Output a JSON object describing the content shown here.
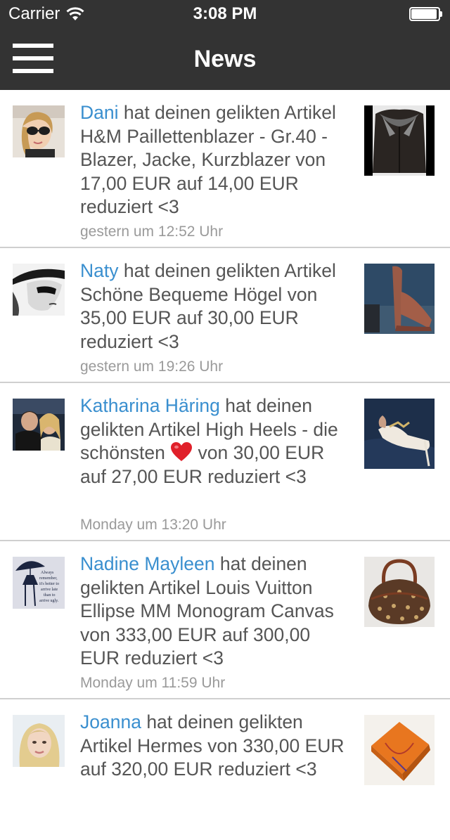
{
  "status_bar": {
    "carrier": "Carrier",
    "time": "3:08 PM"
  },
  "nav": {
    "title": "News",
    "menu_icon": "hamburger-menu-icon"
  },
  "colors": {
    "bar_background": "#333333",
    "username_link": "#3a8fcf",
    "body_text": "#555555",
    "timestamp_text": "#9a9a9a",
    "separator": "#cfcfcf"
  },
  "feed": {
    "items": [
      {
        "user": "Dani",
        "text": " hat deinen gelikten Artikel H&M Paillettenblazer - Gr.40 - Blazer, Jacke, Kurzblazer von 17,00 EUR auf 14,00 EUR reduziert <3",
        "time": "gestern um 12:52 Uhr",
        "avatar": "avatar-photo",
        "thumbnail": "blazer-photo"
      },
      {
        "user": "Naty",
        "text": " hat deinen gelikten Artikel Schöne Bequeme Högel von 35,00 EUR auf 30,00 EUR reduziert <3",
        "time": "gestern um 19:26 Uhr",
        "avatar": "avatar-photo",
        "thumbnail": "high-heel-photo"
      },
      {
        "user": "Katharina Häring",
        "text_before_emoji": " hat deinen gelikten Artikel High Heels - die schönsten ",
        "emoji": "heart-icon",
        "text_after_emoji": " von 30,00 EUR auf 27,00 EUR reduziert <3",
        "time": "Monday um 13:20 Uhr",
        "avatar": "avatar-photo",
        "thumbnail": "white-heels-photo"
      },
      {
        "user": "Nadine Mayleen",
        "text": " hat deinen gelikten Artikel Louis Vuitton Ellipse MM Monogram Canvas von 333,00 EUR auf 300,00 EUR reduziert <3",
        "time": "Monday um 11:59 Uhr",
        "avatar": "avatar-photo",
        "avatar_caption": "Always remember, it's better to arrive late than to arrive ugly.",
        "thumbnail": "handbag-photo"
      },
      {
        "user": "Joanna",
        "text": " hat deinen gelikten Artikel Hermes von 330,00 EUR auf 320,00 EUR reduziert <3",
        "avatar": "avatar-photo",
        "thumbnail": "orange-box-photo"
      }
    ]
  }
}
